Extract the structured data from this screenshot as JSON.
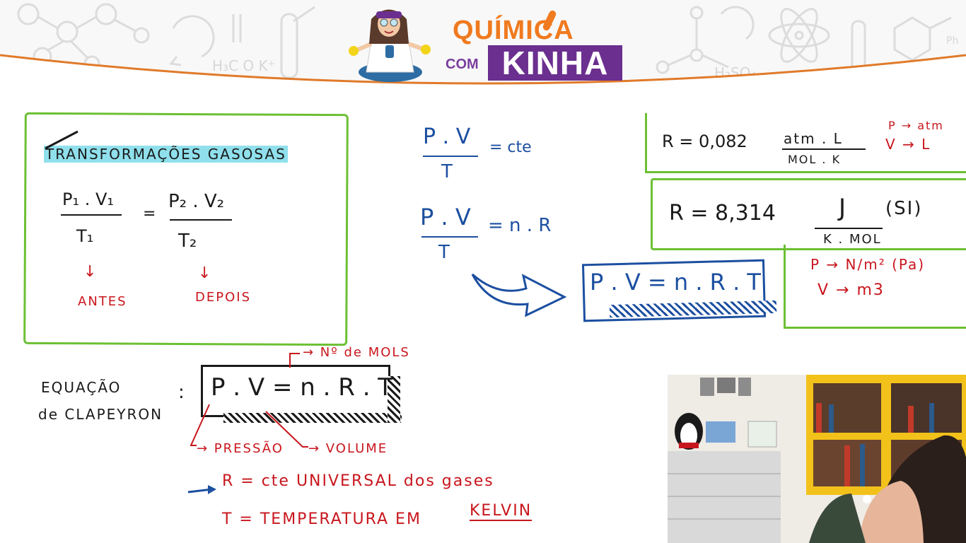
{
  "brand": {
    "line1": "QUÍMICA",
    "connector": "COM",
    "line2": "KINHA"
  },
  "header_decor": {
    "formula_left": "H₃C O K⁺",
    "formula_right": "H₂SO₄",
    "ph_label": "Ph"
  },
  "gas_box": {
    "title": "TRANSFORMAÇÕES GASOSAS",
    "p1v1": "P₁ . V₁",
    "t1": "T₁",
    "equals": "=",
    "p2v2": "P₂ . V₂",
    "t2": "T₂",
    "antes": "ANTES",
    "depois": "DEPOIS",
    "arrow": "↓"
  },
  "middle": {
    "pv": "P . V",
    "t": "T",
    "eq_cte": "= cte",
    "eq_nr": "= n . R",
    "pvnrt": "P . V = n . R . T"
  },
  "r_atm": {
    "r_value": "R = 0,082",
    "unit_num": "atm . L",
    "unit_den": "MOL . K",
    "p_unit": "P → atm",
    "v_unit": "V → L"
  },
  "r_si": {
    "r_value": "R = 8,314",
    "unit_num": "J",
    "unit_den": "K . MOL",
    "si": "(SI)",
    "p_unit": "P → N/m² (Pa)",
    "v_unit": "V → m3"
  },
  "clapeyron": {
    "label_line1": "EQUAÇÃO",
    "label_line2": "de CLAPEYRON",
    "colon": ":",
    "formula": "P . V = n . R . T",
    "n_mols": "→ Nº de MOLS",
    "pressao": "→ PRESSÃO",
    "volume": "→ VOLUME",
    "r_def": "R = cte UNIVERSAL dos gases",
    "t_def": "T = TEMPERATURA EM",
    "kelvin": "KELVIN"
  },
  "colors": {
    "blue_ink": "#1c4fa0",
    "red_ink": "#c8161d",
    "green_border": "#6cc033",
    "highlight": "#8fe0ec",
    "brand_orange": "#f07a1f",
    "brand_purple": "#6b2f8f",
    "header_curve": "#e07a2a"
  }
}
